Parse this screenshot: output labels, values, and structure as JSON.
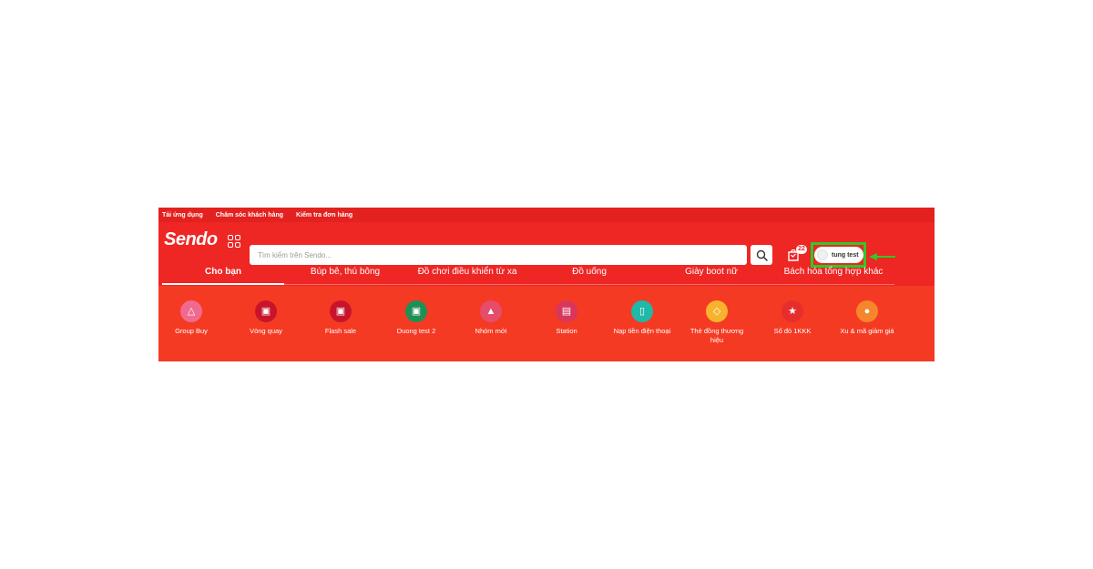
{
  "topbar": {
    "links": [
      "Tải ứng dụng",
      "Chăm sóc khách hàng",
      "Kiểm tra đơn hàng"
    ]
  },
  "header": {
    "logo": "Sendo",
    "search_placeholder": "Tìm kiếm trên Sendo...",
    "cart_count": "22",
    "user_name": "tung test"
  },
  "tabs": [
    {
      "label": "Cho bạn"
    },
    {
      "label": "Búp bê, thú bông"
    },
    {
      "label": "Đồ chơi điều khiển từ xa"
    },
    {
      "label": "Đồ uống"
    },
    {
      "label": "Giày boot nữ"
    },
    {
      "label": "Bách hóa tổng hợp khác"
    }
  ],
  "categories": [
    {
      "label": "Group Buy",
      "icon": "group-buy-icon",
      "color": "#f06a8f"
    },
    {
      "label": "Vòng quay",
      "icon": "spin-wheel-icon",
      "color": "#c8142b"
    },
    {
      "label": "Flash sale",
      "icon": "flash-sale-icon",
      "color": "#c8142b"
    },
    {
      "label": "Duong test 2",
      "icon": "duong-test-icon",
      "color": "#1f8f55"
    },
    {
      "label": "Nhóm mới",
      "icon": "new-group-icon",
      "color": "#e54d6b"
    },
    {
      "label": "Station",
      "icon": "station-icon",
      "color": "#d9365c"
    },
    {
      "label": "Nạp tiền điện thoại",
      "icon": "phone-topup-icon",
      "color": "#20b8a8"
    },
    {
      "label": "Thẻ đồng thương hiệu",
      "icon": "cobrand-card-icon",
      "color": "#f7b32b"
    },
    {
      "label": "Số đỏ 1KKK",
      "icon": "lucky-draw-icon",
      "color": "#e62e2e"
    },
    {
      "label": "Xu & mã giảm giá",
      "icon": "coupon-icon",
      "color": "#f5862b"
    }
  ],
  "colors": {
    "brand_red": "#ee2624",
    "highlight_green": "#2fc82a"
  }
}
